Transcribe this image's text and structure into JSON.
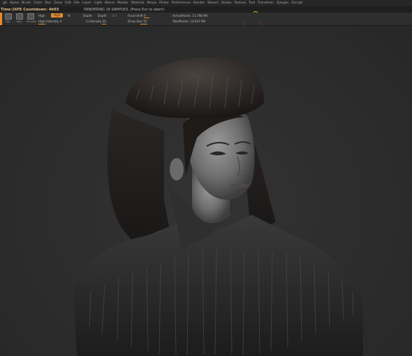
{
  "menu": {
    "items": [
      "git",
      "Alpha",
      "Brush",
      "Color",
      "Doc",
      "Draw",
      "Edit",
      "File",
      "Layer",
      "Light",
      "Macro",
      "Marker",
      "Material",
      "Movie",
      "Picker",
      "Preferences",
      "Render",
      "Stencil",
      "Stroke",
      "Texture",
      "Tool",
      "Transform",
      "Zplugin",
      "Zscript"
    ]
  },
  "status": {
    "timer": "Time:16FE Countdown: 4h03",
    "message": "RENDERING 16 SAMPLED. (Press Esc to abort)"
  },
  "toolbar": {
    "buttons": [
      "Bpr",
      "Spix",
      "Preview"
    ],
    "quality_label": "High",
    "quality_value": "High",
    "quality_tail": "N",
    "high_intensity": "High Intensity 3",
    "depth_label": "Depth",
    "depth_value": "Depth",
    "depth_dim": "Dof",
    "intensity": "2 Intensity 20",
    "focal_shift": "Focal Shift 0",
    "draw_size": "Draw Size 55",
    "active_points": "ActivePoints: 13,798 Mil",
    "total_points": "TotalPoints: 13,937 Mil"
  },
  "accent_color": "#e88a2a",
  "viewport": {
    "content": "bpr-render-woman-fur",
    "background": "#2c2c2c"
  }
}
